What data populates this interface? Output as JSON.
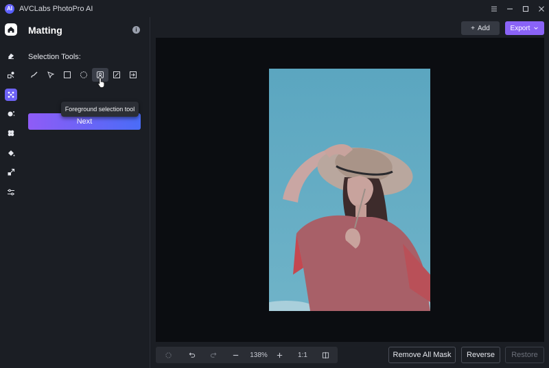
{
  "window": {
    "title": "AVCLabs PhotoPro AI",
    "logo_text": "AI"
  },
  "panel": {
    "title": "Matting",
    "selection_tools_label": "Selection Tools:",
    "tooltip": "Foreground selection tool",
    "next_label": "Next"
  },
  "rail": {
    "items": [
      "home",
      "eraser",
      "enhance",
      "matting",
      "object-removal",
      "colorize",
      "fill",
      "upscale",
      "adjust"
    ],
    "active": "matting"
  },
  "tools": [
    "brush",
    "lasso",
    "rectangle",
    "ellipse",
    "foreground-selection",
    "edit",
    "exit"
  ],
  "active_tool": "foreground-selection",
  "toolbar": {
    "add_label": "Add",
    "export_label": "Export"
  },
  "bottom": {
    "zoom_label": "138%",
    "ratio_label": "1:1",
    "remove_all_mask_label": "Remove All Mask",
    "reverse_label": "Reverse",
    "restore_label": "Restore"
  },
  "colors": {
    "accent": "#8a63f6",
    "gradient_start": "#8f5cf6",
    "gradient_end": "#4a6cf7",
    "background": "#1b1e24",
    "canvas": "#0b0d11"
  }
}
